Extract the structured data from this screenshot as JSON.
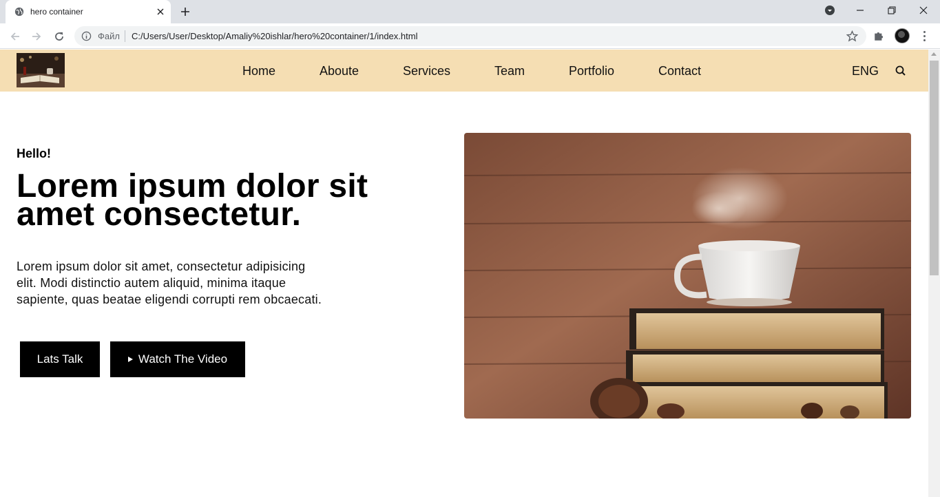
{
  "browser": {
    "tab_title": "hero container",
    "omnibox_scheme": "Файл",
    "url": "C:/Users/User/Desktop/Amaliy%20ishlar/hero%20container/1/index.html"
  },
  "site": {
    "nav": [
      {
        "label": "Home"
      },
      {
        "label": "Aboute"
      },
      {
        "label": "Services"
      },
      {
        "label": "Team"
      },
      {
        "label": "Portfolio"
      },
      {
        "label": "Contact"
      }
    ],
    "language": "ENG",
    "header_color": "#f5deb3"
  },
  "hero": {
    "greeting": "Hello!",
    "title": "Lorem ipsum dolor sit amet consectetur.",
    "text": "Lorem ipsum dolor sit amet, consectetur adipisicing elit. Modi distinctio autem aliquid, minima itaque sapiente, quas beatae eligendi corrupti rem obcaecati.",
    "primary_button": "Lats Talk",
    "secondary_button": "Watch The Video"
  },
  "icons": {
    "tab_favicon": "globe-icon",
    "search": "search-icon",
    "play": "play-icon",
    "bookmark": "star-icon",
    "extensions": "puzzle-icon"
  }
}
